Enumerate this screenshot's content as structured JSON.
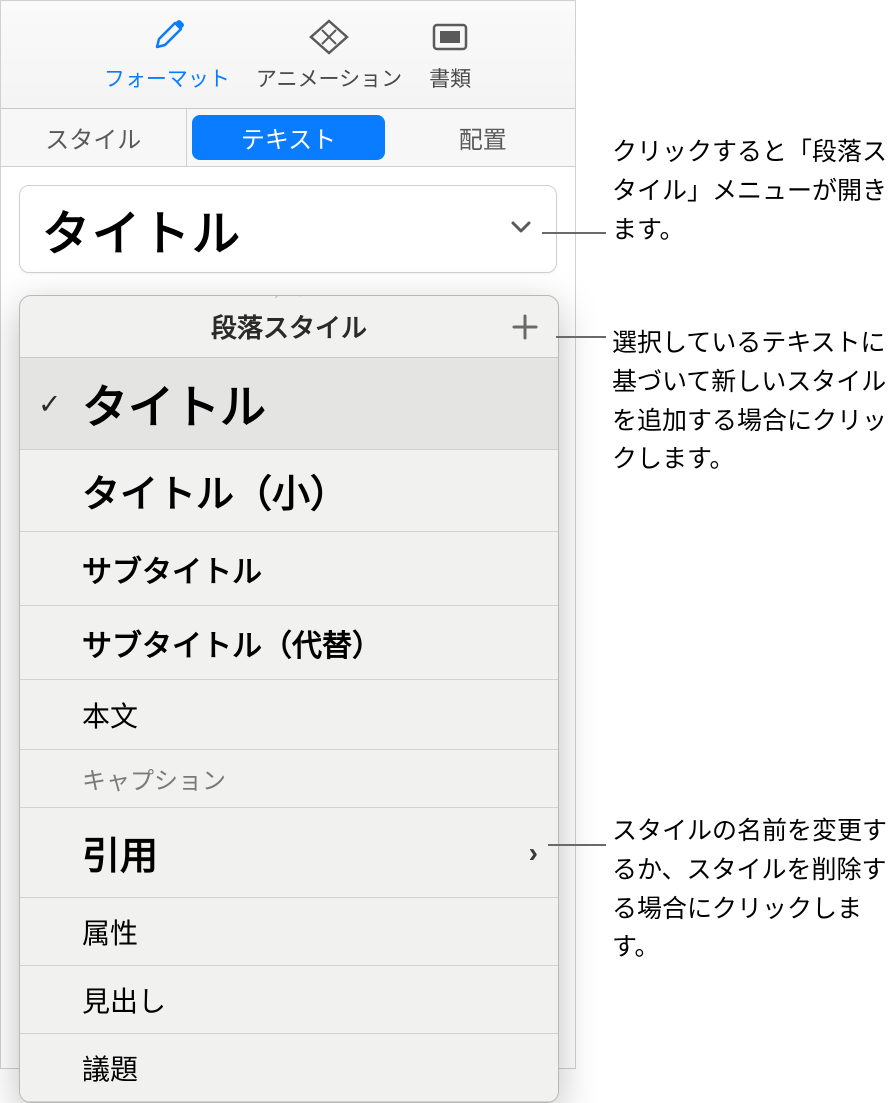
{
  "toolbar": {
    "format": "フォーマット",
    "animation": "アニメーション",
    "document": "書類"
  },
  "tabs": {
    "style": "スタイル",
    "text": "テキスト",
    "arrange": "配置"
  },
  "style_button": {
    "label": "タイトル"
  },
  "popover": {
    "title": "段落スタイル",
    "styles": [
      {
        "label": "タイトル"
      },
      {
        "label": "タイトル（小）"
      },
      {
        "label": "サブタイトル"
      },
      {
        "label": "サブタイトル（代替）"
      },
      {
        "label": "本文"
      },
      {
        "label": "キャプション"
      },
      {
        "label": "引用"
      },
      {
        "label": "属性"
      },
      {
        "label": "見出し"
      },
      {
        "label": "議題"
      }
    ]
  },
  "callouts": {
    "open_menu": "クリックすると「段落スタイル」メニューが開きます。",
    "add_style": "選択しているテキストに基づいて新しいスタイルを追加する場合にクリックします。",
    "rename_delete": "スタイルの名前を変更するか、スタイルを削除する場合にクリックします。"
  }
}
